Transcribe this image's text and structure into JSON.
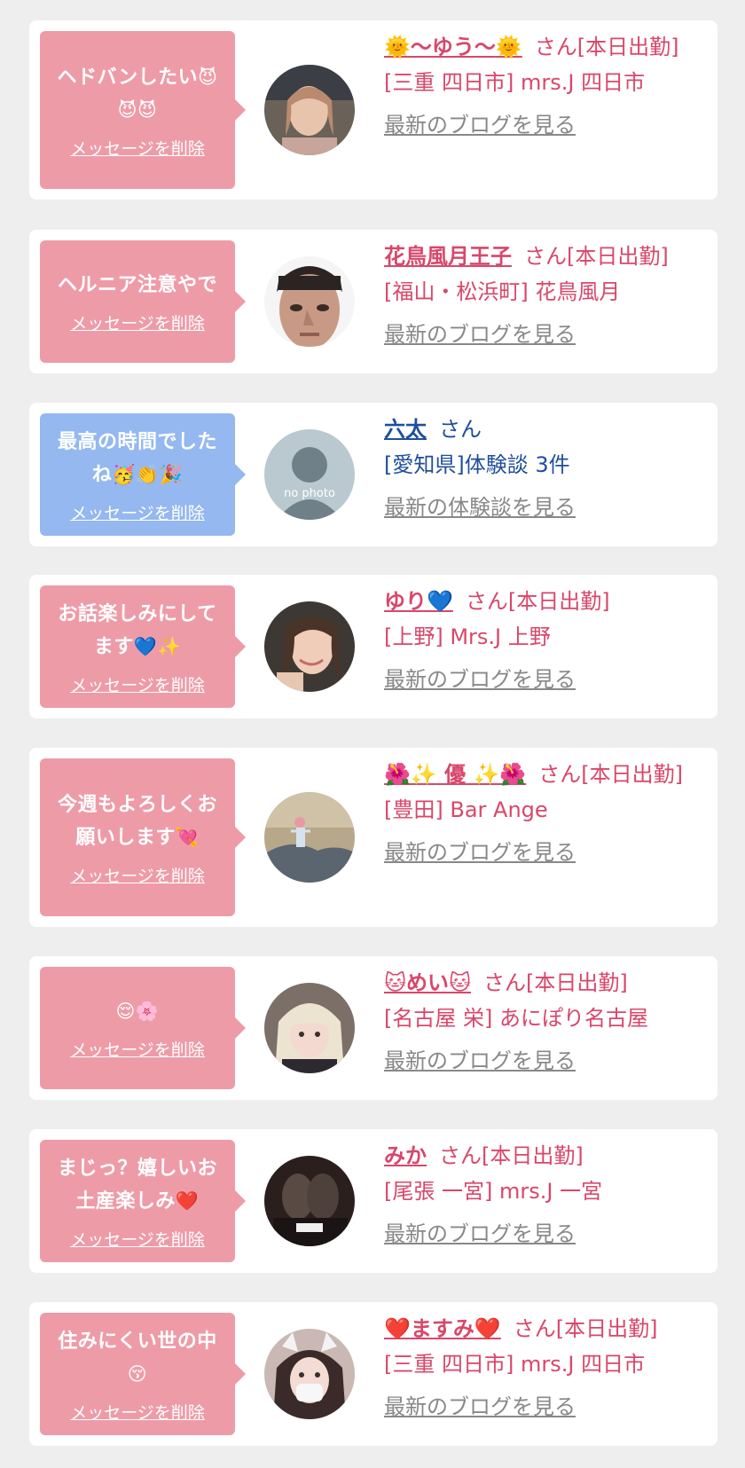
{
  "delete_label": "メッセージを削除",
  "blog_label": "最新のブログを見る",
  "review_label": "最新の体験談を見る",
  "cards": [
    {
      "message": "ヘドバンしたい",
      "message_emoji": "😈",
      "message_emoji_line2": "😈😈",
      "name_prefix": "🌞",
      "name": "～ゆう～",
      "name_suffix": "🌞",
      "suffix": "さん[本日出勤]",
      "shop": "[三重 四日市] mrs.J 四日市"
    },
    {
      "message": "ヘルニア注意やで",
      "name": "花鳥風月王子",
      "suffix": "さん[本日出勤]",
      "shop": "[福山・松浜町] 花鳥風月"
    },
    {
      "message": "最高の時間でした",
      "message_line2": "ね",
      "message_emoji": "🥳👏🎉",
      "name": "六太",
      "suffix": "さん",
      "shop": "[愛知県]体験談 3件",
      "avatar_text": "no photo"
    },
    {
      "message": "お話楽しみにして",
      "message_line2": "ます",
      "message_emoji": "💙✨",
      "name": "ゆり",
      "name_suffix": "💙",
      "suffix": "さん[本日出勤]",
      "shop": "[上野] Mrs.J 上野"
    },
    {
      "message": "今週もよろしくお",
      "message_line2": "願いします",
      "message_emoji": "💘",
      "name_prefix": "🌺✨",
      "name": "優",
      "name_suffix": "✨🌺",
      "suffix": "さん[本日出勤]",
      "shop": "[豊田] Bar Ange"
    },
    {
      "message_emoji": "😌🌸",
      "name_prefix": "🐱",
      "name": "めい",
      "name_suffix": "🐱",
      "suffix": "さん[本日出勤]",
      "shop": "[名古屋 栄] あにぽり名古屋"
    },
    {
      "message": "まじっ？嬉しいお",
      "message_line2": "土産楽しみ",
      "message_emoji": "❤️",
      "name": "みか",
      "suffix": "さん[本日出勤]",
      "shop": "[尾張 一宮] mrs.J 一宮"
    },
    {
      "message": "住みにくい世の中",
      "message_emoji": "😚",
      "name_prefix": "❤️",
      "name": "ますみ",
      "name_suffix": "❤️",
      "suffix": "さん[本日出勤]",
      "shop": "[三重 四日市] mrs.J 四日市"
    }
  ]
}
